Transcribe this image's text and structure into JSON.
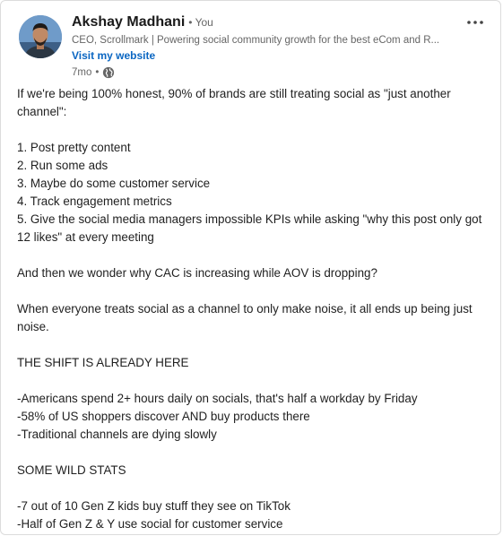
{
  "author": {
    "name": "Akshay Madhani",
    "you_label": "• You",
    "headline": "CEO, Scrollmark | Powering social community growth for the best eCom and R...",
    "visit_link": "Visit my website",
    "time": "7mo",
    "separator": "•",
    "visibility_icon": "globe-icon"
  },
  "menu_icon": "more-horizontal-icon",
  "post": {
    "lines": [
      "If we're being 100% honest, 90% of brands are still treating social as \"just another channel\":",
      "",
      "1. Post pretty content",
      "2. Run some ads",
      "3. Maybe do some customer service",
      "4. Track engagement metrics",
      "5. Give the social media managers impossible KPIs while asking \"why this post only got 12 likes\" at every meeting",
      "",
      "And then we wonder why CAC is increasing while AOV is dropping?",
      "",
      "When everyone treats social as a channel to only make noise, it all ends up being just noise.",
      "",
      "THE SHIFT IS ALREADY HERE",
      "",
      "-Americans spend 2+ hours daily on socials, that's half a workday by Friday",
      "-58% of US shoppers discover AND buy products there",
      "-Traditional channels are dying slowly",
      "",
      "SOME WILD STATS",
      "",
      "-7 out of 10 Gen Z kids buy stuff they see on TikTok",
      "-Half of Gen Z & Y use social for customer service"
    ]
  },
  "colors": {
    "link": "#0a66c2",
    "muted": "#666666",
    "text": "#1f1f1f",
    "border": "#dcdcdc"
  }
}
